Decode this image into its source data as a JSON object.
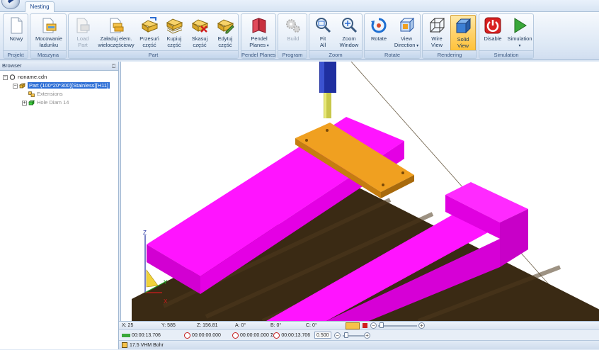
{
  "tab": {
    "label": "Nesting"
  },
  "ribbon": {
    "groups": [
      {
        "label": "Projekt",
        "buttons": [
          {
            "line1": "Nowy",
            "line2": ""
          }
        ]
      },
      {
        "label": "Maszyna",
        "buttons": [
          {
            "line1": "Mocowanie",
            "line2": "ładunku"
          }
        ]
      },
      {
        "label": "Part",
        "buttons": [
          {
            "line1": "Load",
            "line2": "Part"
          },
          {
            "line1": "Załaduj elem.",
            "line2": "wieloczęściowy"
          },
          {
            "line1": "Przesuń",
            "line2": "część"
          },
          {
            "line1": "Kupiuj",
            "line2": "część"
          },
          {
            "line1": "Skasuj",
            "line2": "część"
          },
          {
            "line1": "Edytuj",
            "line2": "część"
          }
        ]
      },
      {
        "label": "Pendel Planes",
        "buttons": [
          {
            "line1": "Pendel",
            "line2": "Planes"
          }
        ]
      },
      {
        "label": "Program",
        "buttons": [
          {
            "line1": "Build",
            "line2": ""
          }
        ]
      },
      {
        "label": "Zoom",
        "buttons": [
          {
            "line1": "Fit",
            "line2": "All"
          },
          {
            "line1": "Zoom",
            "line2": "Window"
          }
        ]
      },
      {
        "label": "Rotate",
        "buttons": [
          {
            "line1": "Rotate",
            "line2": ""
          },
          {
            "line1": "View",
            "line2": "Direction"
          }
        ]
      },
      {
        "label": "Rendering",
        "buttons": [
          {
            "line1": "Wire",
            "line2": "View"
          },
          {
            "line1": "Solid",
            "line2": "View"
          }
        ]
      },
      {
        "label": "Simulation",
        "buttons": [
          {
            "line1": "Disable",
            "line2": ""
          },
          {
            "line1": "Simulation",
            "line2": ""
          }
        ]
      }
    ]
  },
  "browser": {
    "title": "Browser",
    "tree": [
      {
        "label": "noname.cdn"
      },
      {
        "label": "Part (100*20*300)[Stainless][H11]"
      },
      {
        "label": "Extensions"
      },
      {
        "label": "Hole Diam 14"
      }
    ]
  },
  "viewport": {
    "axis_x": "X",
    "axis_y": "Y",
    "axis_z": "Z",
    "colors": {
      "base": "#ff00ff",
      "part": "#f0a020",
      "floor": "#3a2a14",
      "spindle": "#1f2fa0",
      "tool": "#c8c84a"
    }
  },
  "coords": {
    "x": "X: 25",
    "y": "Y: 585",
    "z": "Z: 156.81",
    "a": "A: 0°",
    "b": "B: 0°",
    "c": "C: 0°"
  },
  "timers": {
    "t1": "00:00:13.706",
    "t2": "00:00:00.000",
    "t3": "00:00:00.000",
    "total_prefix": "Σ",
    "total": "00:00:13.706",
    "speed": "0.500"
  },
  "tool": {
    "name": "17.5 VHM Bohr"
  }
}
